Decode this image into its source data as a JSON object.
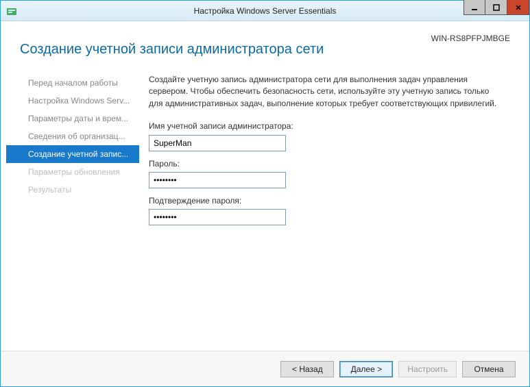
{
  "window": {
    "title": "Настройка Windows Server Essentials",
    "machine_name": "WIN-RS8PFPJMBGE"
  },
  "page_title": "Создание учетной записи администратора сети",
  "sidebar": {
    "items": [
      {
        "label": "Перед началом работы",
        "state": "done"
      },
      {
        "label": "Настройка Windows Serv...",
        "state": "done"
      },
      {
        "label": "Параметры даты и врем...",
        "state": "done"
      },
      {
        "label": "Сведения об организац...",
        "state": "done"
      },
      {
        "label": "Создание учетной запис...",
        "state": "active"
      },
      {
        "label": "Параметры обновления",
        "state": "upcoming"
      },
      {
        "label": "Результаты",
        "state": "upcoming"
      }
    ]
  },
  "content": {
    "description": "Создайте учетную запись администратора сети для выполнения задач управления сервером. Чтобы обеспечить безопасность сети, используйте эту учетную запись только для административных задач, выполнение которых требует соответствующих привилегий.",
    "username_label": "Имя учетной записи администратора:",
    "username_value": "SuperMan",
    "password_label": "Пароль:",
    "password_value": "********",
    "confirm_label": "Подтверждение пароля:",
    "confirm_value": "********"
  },
  "footer": {
    "back_label": "< Назад",
    "next_label": "Далее >",
    "configure_label": "Настроить",
    "cancel_label": "Отмена"
  }
}
